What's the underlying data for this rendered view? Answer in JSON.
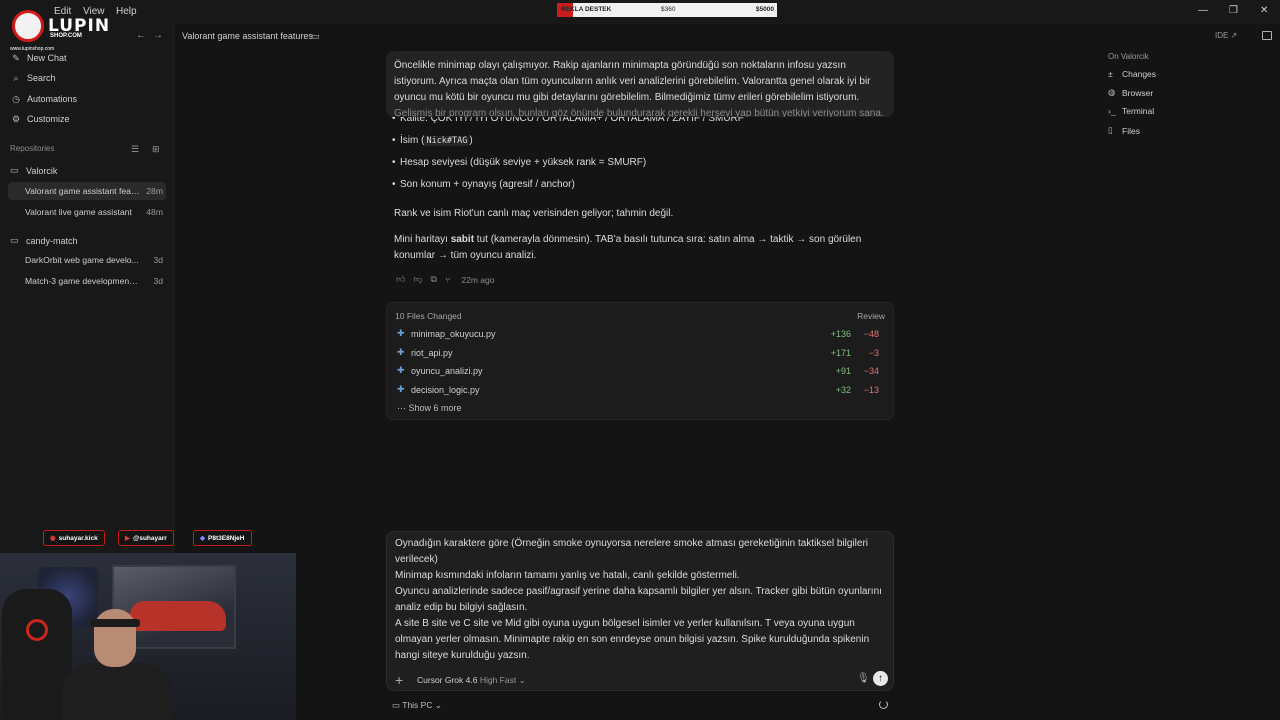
{
  "menu": [
    "Edit",
    "View",
    "Help"
  ],
  "window_controls": [
    "—",
    "❐",
    "✕"
  ],
  "logo": {
    "brand": "LUPIN",
    "brand_sub": "SHOP.COM",
    "site": "www.lupinshop.com"
  },
  "donation": {
    "label": "REKLA DESTEK",
    "current": "$360",
    "goal": "$5000",
    "accent": "#c91d1d"
  },
  "sidebar": {
    "nav": [
      {
        "label": "New Chat",
        "icon": "new-chat-icon"
      },
      {
        "label": "Search",
        "icon": "search-icon"
      },
      {
        "label": "Automations",
        "icon": "clock-icon"
      },
      {
        "label": "Customize",
        "icon": "sliders-icon"
      }
    ],
    "repos_label": "Repositories",
    "repos": [
      {
        "name": "Valorcik",
        "threads": [
          {
            "title": "Valorant game assistant feat...",
            "age": "28m",
            "active": true
          },
          {
            "title": "Valorant live game assistant",
            "age": "48m",
            "active": false
          }
        ]
      },
      {
        "name": "candy-match",
        "threads": [
          {
            "title": "DarkOrbit web game develo...",
            "age": "3d",
            "active": false
          },
          {
            "title": "Match-3 game development ...",
            "age": "3d",
            "active": false
          }
        ]
      }
    ]
  },
  "header": {
    "title": "Valorant game assistant features",
    "ide_label": "IDE ↗"
  },
  "right_panel": {
    "title": "On Valorcik",
    "items": [
      {
        "label": "Changes",
        "icon": "plus-minus-icon"
      },
      {
        "label": "Browser",
        "icon": "globe-icon"
      },
      {
        "label": "Terminal",
        "icon": "terminal-icon"
      },
      {
        "label": "Files",
        "icon": "file-icon"
      }
    ]
  },
  "chat": {
    "user_message": "Öncelikle minimap olayı çalışmıyor. Rakip ajanların minimapta göründüğü son noktaların infosu yazsın istiyorum. Ayrıca maçta olan tüm oyuncuların anlık veri analizlerini görebilelim. Valorantta genel olarak iyi bir oyuncu mu kötü bir oyuncu mu gibi detaylarını görebilelim. Bilmediğimiz tümv erileri görebilelim istiyorum.",
    "user_message_fade": "Gelişmiş bir program olsun, bunları göz önünde bulundurarak gerekli herşeyi yap bütün yetkiyi veriyorum sana.",
    "bullets": [
      {
        "text": "Kalite: ÇOK İYİ / İYİ OYUNCU / ORTALAMA+ / ORTALAMA / ZAYIF / SMURF"
      },
      {
        "pre": "İsim (",
        "code": "Nick#TAG",
        "post": ")"
      },
      {
        "text": "Hesap seviyesi (düşük seviye + yüksek rank = SMURF)"
      },
      {
        "text": "Son konum + oynayış (agresif / anchor)"
      }
    ],
    "para1": "Rank ve isim Riot'un canlı maç verisinden geliyor; tahmin değil.",
    "para2_pre": "Mini haritayı ",
    "para2_bold": "sabit",
    "para2_post": " tut (kamerayla dönmesin). TAB'a basılı tutunca sıra: satın alma → taktik → son görülen konumlar → tüm oyuncu analizi.",
    "message_age": "22m ago",
    "files": {
      "header": "10 Files Changed",
      "review": "Review",
      "items": [
        {
          "name": "minimap_okuyucu.py",
          "add": "+136",
          "del": "−48"
        },
        {
          "name": "riot_api.py",
          "add": "+171",
          "del": "−3"
        },
        {
          "name": "oyuncu_analizi.py",
          "add": "+91",
          "del": "−34"
        },
        {
          "name": "decision_logic.py",
          "add": "+32",
          "del": "−13"
        }
      ],
      "show_more": "Show 6 more"
    }
  },
  "composer": {
    "lines": [
      "Oynadığın karaktere göre (Örneğin smoke oynuyorsa nerelere smoke atması gereketiğinin taktiksel bilgileri verilecek)",
      "Minimap kısmındaki infoların tamamı yanlış ve hatalı, canlı şekilde göstermeli.",
      "Oyuncu analizlerinde sadece pasif/agrasif yerine daha kapsamlı bilgiler yer alsın. Tracker gibi bütün oyunlarını analiz edip bu bilgiyi sağlasın.",
      "A site B site ve C site ve Mid gibi oyuna uygun bölgesel isimler ve yerler kullanılsın. T veya oyuna uygun olmayan yerler olmasın. Minimapte rakip en son enrdeyse onun bilgisi yazsın. Spike kurulduğunda spikenin hangi siteye kurulduğu yazsın."
    ],
    "model": "Cursor Grok 4.6",
    "model_mode": "High Fast ⌄",
    "location": "This PC ⌄"
  },
  "overlay": {
    "socials": [
      {
        "icon": "kick-icon",
        "handle": "suhayar.kick"
      },
      {
        "icon": "youtube-icon",
        "handle": "@suhayarr"
      },
      {
        "icon": "discord-icon",
        "handle": "P8t3E8NjeH"
      }
    ]
  }
}
